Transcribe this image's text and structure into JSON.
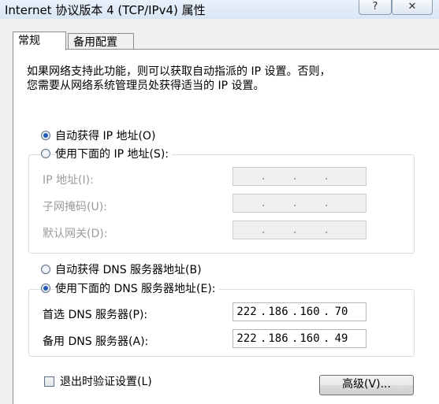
{
  "window": {
    "title": "Internet 协议版本 4 (TCP/IPv4) 属性",
    "help_glyph": "?",
    "close_glyph": "✕"
  },
  "tabs": [
    {
      "label": "常规"
    },
    {
      "label": "备用配置"
    }
  ],
  "intro": {
    "line1": "如果网络支持此功能，则可以获取自动指派的 IP 设置。否则，",
    "line2": "您需要从网络系统管理员处获得适当的 IP 设置。"
  },
  "ip_section": {
    "auto_label": "自动获得 IP 地址(O)",
    "manual_label": "使用下面的 IP 地址(S):",
    "selected": "auto",
    "fields": [
      {
        "label": "IP 地址(I):",
        "octets": [
          "",
          "",
          "",
          ""
        ]
      },
      {
        "label": "子网掩码(U):",
        "octets": [
          "",
          "",
          "",
          ""
        ]
      },
      {
        "label": "默认网关(D):",
        "octets": [
          "",
          "",
          "",
          ""
        ]
      }
    ]
  },
  "dns_section": {
    "auto_label": "自动获得 DNS 服务器地址(B)",
    "manual_label": "使用下面的 DNS 服务器地址(E):",
    "selected": "manual",
    "fields": [
      {
        "label": "首选 DNS 服务器(P):",
        "octets": [
          "222",
          "186",
          "160",
          "70"
        ]
      },
      {
        "label": "备用 DNS 服务器(A):",
        "octets": [
          "222",
          "186",
          "160",
          "49"
        ]
      }
    ]
  },
  "footer": {
    "validate_label": "退出时验证设置(L)",
    "validate_checked": false,
    "advanced_label": "高级(V)..."
  },
  "colors": {
    "radio_dot": "#1f5cb8",
    "disabled_text": "#9a9a9a"
  }
}
